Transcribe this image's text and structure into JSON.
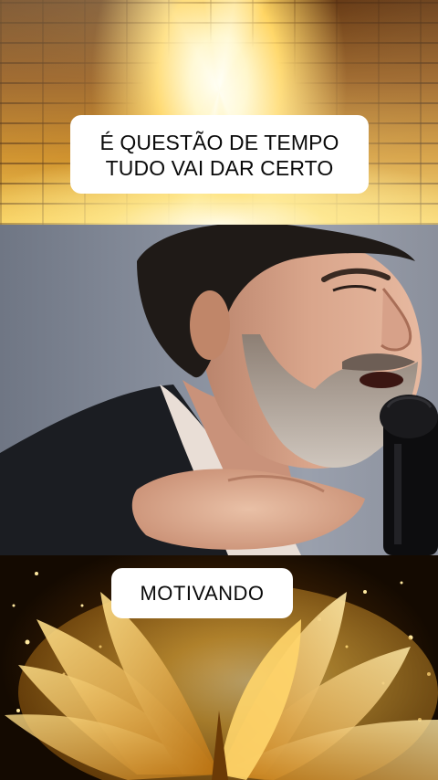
{
  "captions": {
    "top_line_1": "É QUESTÃO DE TEMPO",
    "top_line_2": "TUDO VAI DAR CERTO",
    "bottom": "MOTIVANDO"
  },
  "images": {
    "top_background": "golden-brick-tunnel-light",
    "video_frame": "bearded-man-speaking-into-microphone",
    "bottom_background": "glowing-open-golden-book"
  },
  "colors": {
    "caption_bg": "#ffffff",
    "caption_text": "#0a0a0a",
    "gold": "#f7c948"
  }
}
